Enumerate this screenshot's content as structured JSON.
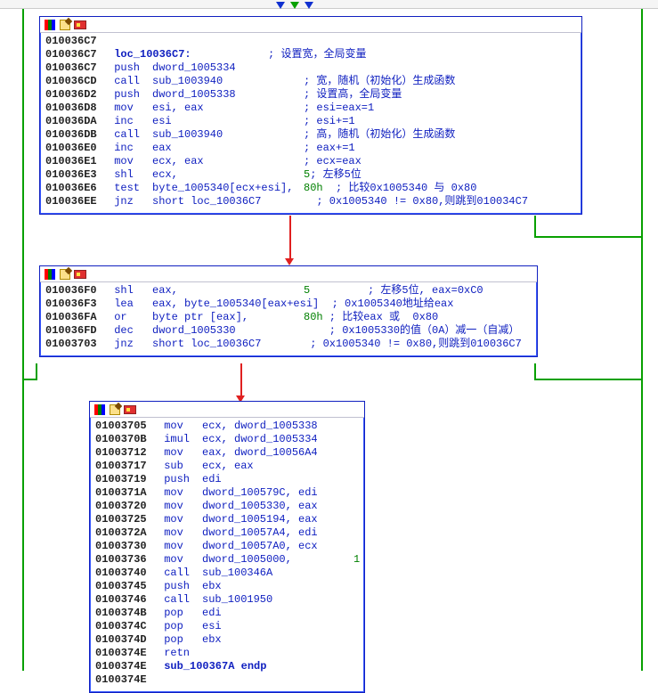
{
  "top_markers": [
    "▼",
    "▼",
    "▼"
  ],
  "block1": {
    "titlebar_icons": [
      "colors",
      "edit",
      "flag"
    ],
    "rows": [
      {
        "addr": "010036C7",
        "mnem": "",
        "ops": "",
        "cmt": ""
      },
      {
        "addr": "010036C7",
        "mnem": "",
        "ops": "",
        "cmt": "; 设置宽，全局变量",
        "label": "loc_10036C7:"
      },
      {
        "addr": "010036C7",
        "mnem": "push",
        "ops": "dword_1005334",
        "cmt": ""
      },
      {
        "addr": "010036CD",
        "mnem": "call",
        "ops": "sub_1003940",
        "cmt": "; 宽，随机（初始化）生成函数"
      },
      {
        "addr": "010036D2",
        "mnem": "push",
        "ops": "dword_1005338",
        "cmt": "; 设置高，全局变量"
      },
      {
        "addr": "010036D8",
        "mnem": "mov",
        "ops": "esi, eax",
        "cmt": "; esi=eax=1"
      },
      {
        "addr": "010036DA",
        "mnem": "inc",
        "ops": "esi",
        "cmt": "; esi+=1"
      },
      {
        "addr": "010036DB",
        "mnem": "call",
        "ops": "sub_1003940",
        "cmt": "; 高，随机（初始化）生成函数"
      },
      {
        "addr": "010036E0",
        "mnem": "inc",
        "ops": "eax",
        "cmt": "; eax+=1"
      },
      {
        "addr": "010036E1",
        "mnem": "mov",
        "ops": "ecx, eax",
        "cmt": "; ecx=eax"
      },
      {
        "addr": "010036E3",
        "mnem": "shl",
        "ops": "ecx, ",
        "imm": "5",
        "cmt": "; 左移5位"
      },
      {
        "addr": "010036E6",
        "mnem": "test",
        "ops": "byte_1005340[ecx+esi], ",
        "imm": "80h",
        "cmt": "  ; 比较0x1005340 与 0x80"
      },
      {
        "addr": "010036EE",
        "mnem": "jnz",
        "ops": "short loc_10036C7",
        "cmt": "  ; 0x1005340 != 0x80,则跳到010034C7"
      }
    ]
  },
  "block2": {
    "titlebar_icons": [
      "colors",
      "edit",
      "flag"
    ],
    "rows": [
      {
        "addr": "010036F0",
        "mnem": "shl",
        "ops": "eax, ",
        "imm": "5",
        "cmt": "         ; 左移5位, eax=0xC0"
      },
      {
        "addr": "010036F3",
        "mnem": "lea",
        "ops": "eax, byte_1005340[eax+esi]",
        "cmt": "  ; 0x1005340地址给eax"
      },
      {
        "addr": "010036FA",
        "mnem": "or",
        "ops": "byte ptr [eax], ",
        "imm": "80h",
        "cmt": " ; 比较eax 或  0x80"
      },
      {
        "addr": "010036FD",
        "mnem": "dec",
        "ops": "dword_1005330",
        "cmt": "    ; 0x1005330的值（0A）减一（自减）"
      },
      {
        "addr": "01003703",
        "mnem": "jnz",
        "ops": "short loc_10036C7",
        "cmt": " ; 0x1005340 != 0x80,则跳到010036C7"
      }
    ]
  },
  "block3": {
    "titlebar_icons": [
      "colors",
      "edit",
      "flag"
    ],
    "rows": [
      {
        "addr": "01003705",
        "mnem": "mov",
        "ops": "ecx, dword_1005338",
        "cmt": ""
      },
      {
        "addr": "0100370B",
        "mnem": "imul",
        "ops": "ecx, dword_1005334",
        "cmt": ""
      },
      {
        "addr": "01003712",
        "mnem": "mov",
        "ops": "eax, dword_10056A4",
        "cmt": ""
      },
      {
        "addr": "01003717",
        "mnem": "sub",
        "ops": "ecx, eax",
        "cmt": ""
      },
      {
        "addr": "01003719",
        "mnem": "push",
        "ops": "edi",
        "cmt": ""
      },
      {
        "addr": "0100371A",
        "mnem": "mov",
        "ops": "dword_100579C, edi",
        "cmt": ""
      },
      {
        "addr": "01003720",
        "mnem": "mov",
        "ops": "dword_1005330, eax",
        "cmt": ""
      },
      {
        "addr": "01003725",
        "mnem": "mov",
        "ops": "dword_1005194, eax",
        "cmt": ""
      },
      {
        "addr": "0100372A",
        "mnem": "mov",
        "ops": "dword_10057A4, edi",
        "cmt": ""
      },
      {
        "addr": "01003730",
        "mnem": "mov",
        "ops": "dword_10057A0, ecx",
        "cmt": ""
      },
      {
        "addr": "01003736",
        "mnem": "mov",
        "ops": "dword_1005000, ",
        "imm": "1",
        "cmt": ""
      },
      {
        "addr": "01003740",
        "mnem": "call",
        "ops": "sub_100346A",
        "cmt": ""
      },
      {
        "addr": "01003745",
        "mnem": "push",
        "ops": "ebx",
        "cmt": ""
      },
      {
        "addr": "01003746",
        "mnem": "call",
        "ops": "sub_1001950",
        "cmt": ""
      },
      {
        "addr": "0100374B",
        "mnem": "pop",
        "ops": "edi",
        "cmt": ""
      },
      {
        "addr": "0100374C",
        "mnem": "pop",
        "ops": "esi",
        "cmt": ""
      },
      {
        "addr": "0100374D",
        "mnem": "pop",
        "ops": "ebx",
        "cmt": ""
      },
      {
        "addr": "0100374E",
        "mnem": "retn",
        "ops": "",
        "cmt": ""
      },
      {
        "addr": "0100374E",
        "mnem": "",
        "ops": "",
        "cmt": "",
        "endp": "sub_100367A endp"
      },
      {
        "addr": "0100374E",
        "mnem": "",
        "ops": "",
        "cmt": ""
      }
    ]
  }
}
